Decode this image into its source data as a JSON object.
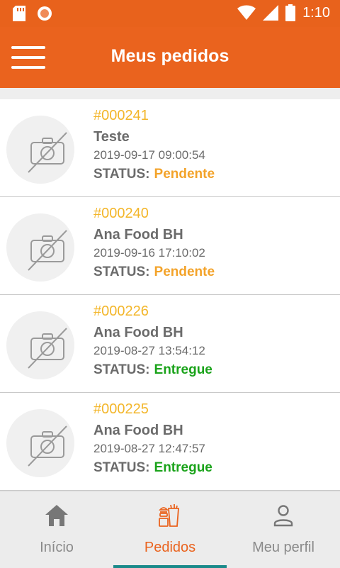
{
  "status_bar": {
    "time": "1:10"
  },
  "header": {
    "title": "Meus pedidos"
  },
  "orders": [
    {
      "code": "#000241",
      "store": "Teste",
      "datetime": "2019-09-17 09:00:54",
      "status_label": "STATUS:",
      "status": "Pendente",
      "status_color": "#f3a32a"
    },
    {
      "code": "#000240",
      "store": "Ana Food BH",
      "datetime": "2019-09-16 17:10:02",
      "status_label": "STATUS:",
      "status": "Pendente",
      "status_color": "#f3a32a"
    },
    {
      "code": "#000226",
      "store": "Ana Food BH",
      "datetime": "2019-08-27 13:54:12",
      "status_label": "STATUS:",
      "status": "Entregue",
      "status_color": "#1aa31a"
    },
    {
      "code": "#000225",
      "store": "Ana Food BH",
      "datetime": "2019-08-27 12:47:57",
      "status_label": "STATUS:",
      "status": "Entregue",
      "status_color": "#1aa31a"
    }
  ],
  "nav": [
    {
      "label": "Início",
      "icon": "home-icon",
      "active": false
    },
    {
      "label": "Pedidos",
      "icon": "food-orders-icon",
      "active": true
    },
    {
      "label": "Meu perfil",
      "icon": "profile-icon",
      "active": false
    }
  ],
  "colors": {
    "primary": "#ea631e",
    "accent_code": "#f3b62a",
    "pending": "#f3a32a",
    "delivered": "#1aa31a",
    "tab_indicator": "#1a8a8a"
  }
}
